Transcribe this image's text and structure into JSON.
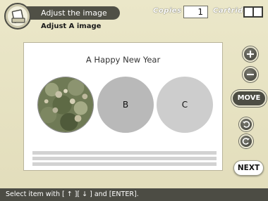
{
  "header": {
    "title": "Adjust the image",
    "subtitle": "Adjust A image",
    "copies_label": "Copies",
    "copies_value": "1",
    "cartridge_label": "Cartridge"
  },
  "card": {
    "title": "A Happy New Year",
    "slots": [
      "",
      "B",
      "C"
    ]
  },
  "controls": {
    "move_label": "MOVE",
    "next_label": "NEXT"
  },
  "footer": {
    "hint": "Select item with [ ↑ ][ ↓ ] and [ENTER]."
  },
  "colors": {
    "background": "#e6e2c2",
    "header_bar": "#505046",
    "button_dark": "#4d4d44"
  },
  "icons": [
    "app-print-icon",
    "plus-icon",
    "minus-icon",
    "rotate-left-icon",
    "rotate-right-icon",
    "cartridge-icon"
  ]
}
